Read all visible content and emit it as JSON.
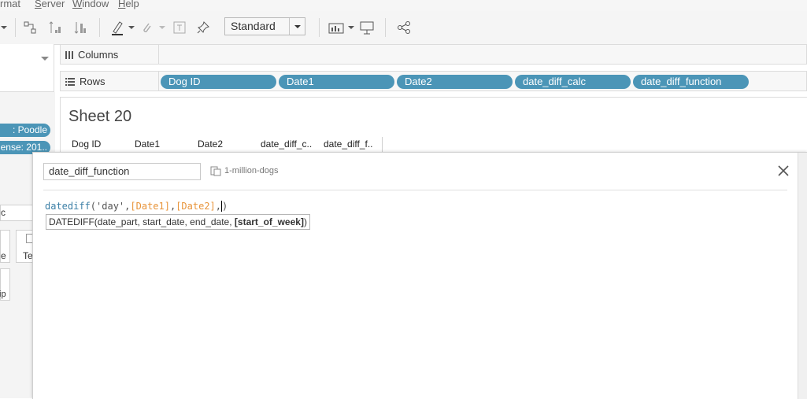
{
  "menu": [
    "rmat",
    "Server",
    "Window",
    "Help"
  ],
  "toolbar": {
    "view_select": "Standard"
  },
  "shelves": {
    "columns_label": "Columns",
    "rows_label": "Rows",
    "row_pills": [
      "Dog ID",
      "Date1",
      "Date2",
      "date_diff_calc",
      "date_diff_function"
    ]
  },
  "left_pills": [
    ": Poodle",
    "ense: 201.."
  ],
  "left_fragments": {
    "c_input": "c",
    "e_label": "e",
    "te_label": "Te",
    "ip_label": "ip"
  },
  "sheet": {
    "title": "Sheet 20",
    "headers": [
      "Dog ID",
      "Date1",
      "Date2",
      "date_diff_c..",
      "date_diff_f.."
    ]
  },
  "calc_dialog": {
    "name": "date_diff_function",
    "datasource": "1-million-dogs",
    "formula": {
      "fn": "datediff",
      "open": "(",
      "arg1": "'day'",
      "sep1": ",",
      "arg2": "[Date1]",
      "sep2": ",",
      "arg3": "[Date2]",
      "sep3": ",",
      "close": ")"
    },
    "tooltip": {
      "prefix": "DATEDIFF(date_part, start_date, end_date, ",
      "optional": "[start_of_week]",
      "suffix": ")"
    }
  },
  "colors": {
    "pill": "#4b95b7",
    "keyword": "#3b7fa6",
    "field": "#e8943a"
  }
}
